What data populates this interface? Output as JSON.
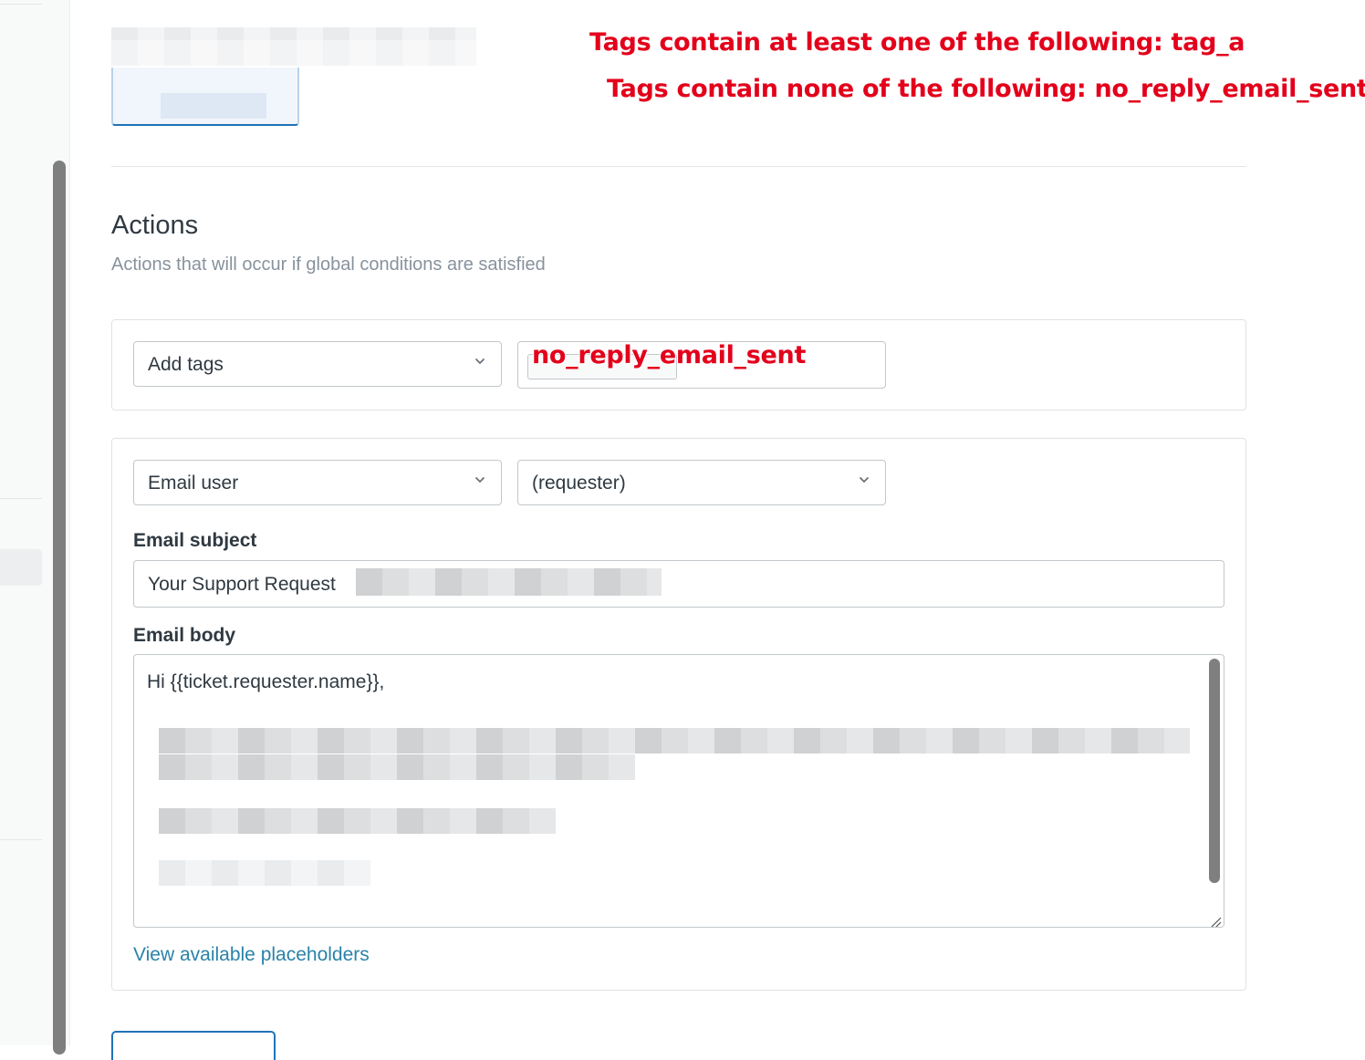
{
  "annotations": {
    "line1": "Tags contain at least one of the following: tag_a",
    "line2": "Tags contain none of the following: no_reply_email_sent",
    "tag_overlay": "no_reply_email_sent"
  },
  "actions": {
    "title": "Actions",
    "subtitle": "Actions that will occur if global conditions are satisfied"
  },
  "action1": {
    "type": "Add tags",
    "tag_value": ""
  },
  "action2": {
    "type": "Email user",
    "recipient": "(requester)",
    "subject_label": "Email subject",
    "subject_value": "Your Support Request",
    "body_label": "Email body",
    "body_first_line": "Hi {{ticket.requester.name}},",
    "placeholders_link": "View available placeholders"
  },
  "icons": {
    "chevron": "chevron-down-icon",
    "resize": "resize-handle-icon"
  },
  "colors": {
    "annotation": "#e3001b",
    "link": "#2a82a8",
    "primary": "#1f73b7"
  }
}
